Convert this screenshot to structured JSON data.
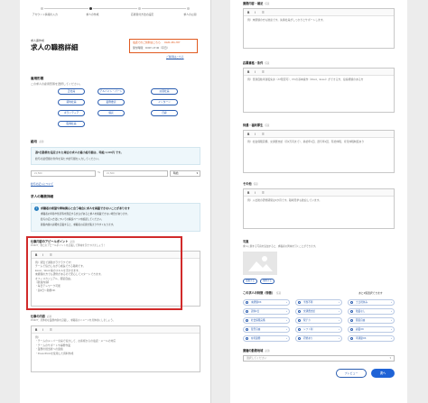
{
  "stepper": {
    "steps": [
      "アカウント情報の入力",
      "求人の作成",
      "応募受付方法の設定",
      "求人の公開"
    ],
    "current": 2
  },
  "header": {
    "subtitle": "求人票作成",
    "title": "求人の職務詳細",
    "help_line1": "電話でのご質問はこちら",
    "help_phone": "0120-451-787",
    "help_hours": "受付時間：9:00〜17:30（平日）",
    "faq_link": "ご質問はこちら"
  },
  "employment": {
    "label": "雇用形態",
    "hint": "この求人の雇用形態を選択してください。",
    "options": [
      "正社員",
      "アルバイト・パート",
      "派遣社員",
      "契約社員",
      "業務委託",
      "インターン",
      "ボランティア",
      "嘱託",
      "日雇",
      "臨時社員"
    ]
  },
  "salary": {
    "label": "給与",
    "required": "必須",
    "notice": "週5日勤務を指定された場合の求人の最小給与額は、時給 1,100円 です。",
    "notice2": "給与の最低額の条件を満たす給与額を入力してください。",
    "min_placeholder": "¥1,500",
    "max_placeholder": "¥1,500",
    "unit": "時給",
    "link": "給与の記入について"
  },
  "details_section": {
    "label": "求人の職務詳細",
    "info_title": "求職者の希望や興味関心と合う場合に求人を掲載できないことがあります",
    "info_lines": [
      "求職者の年齢や性別等を限定する文言があると求人を掲載できない場合があります。",
      "給与の記入方法についての解説ページを確認してください。",
      "募集内容の詳細を記載すると、求職者の応募が集まりやすくなります。"
    ]
  },
  "appeal": {
    "label": "仕事内容のアピールポイント",
    "required": "必須",
    "hint": "POINT：他とのアピールポイントを記載して興味を引きつけましょう！",
    "placeholder_lines": [
      "例）駅近で通勤がラクラクです！",
      "チームで協力しながら成長できる職場です。",
      "Excel、Word 等のスキルを活かせます。",
      "未経験の方でも研修があるので安心してスタートできます。",
      "オフィスカジュアル、服装自由。",
      "【募集内容】",
      "・毎日テレワーク可能",
      "・週2日〜勤務OK"
    ]
  },
  "job_content": {
    "label": "仕事の内容",
    "required": "必須",
    "hint": "POINT：具体的な業務内容を記載し、求職者のイメージを具体的にしましょう。",
    "placeholder_lines": [
      "例）",
      "・チームのメンバー全員で協力して、お客様からの電話・メールの対応",
      "・チームのサポートや事務作業",
      "・業務の担当者への連絡",
      "・PowerPointを使用した資料作成"
    ]
  },
  "right": {
    "appeal_points": {
      "label": "業務内容・補足",
      "required": "任意",
      "placeholder": "例）未経験の方も歓迎です。先輩社員がしっかりとサポートします。"
    },
    "skills": {
      "label": "応募資格・条件",
      "required": "任意",
      "placeholder": "例）普通自動車運転免許（AT限定可）、PCの基本操作（Word、Excel）ができる方、接客経験のある方"
    },
    "welfare": {
      "label": "待遇・福利厚生",
      "required": "任意",
      "placeholder": "例）社会保険完備、交通費支給（月3万円まで）、昇給年1回、賞与年2回、有給休暇、育児休暇制度あり"
    },
    "other": {
      "label": "その他",
      "required": "任意",
      "placeholder": "例）入社後の研修期間は3か月です。職場見学も歓迎しています。"
    },
    "photo": {
      "label": "写真",
      "hint": "求人に関する写真を追加すると、求職者の興味を引くことができます。",
      "btn_change": "変更する",
      "btn_delete": "削除する"
    },
    "features": {
      "label": "この求人の特徴（特徴）",
      "required": "任意",
      "counter": "あと3個選択できます",
      "items": [
        "未経験OK",
        "学歴不問",
        "土日祝休み",
        "週休2日",
        "交通費支給",
        "残業なし",
        "社会保険完備",
        "駅チカ",
        "服装自由",
        "髪型自由",
        "シフト制",
        "副業OK",
        "在宅勤務",
        "研修あり",
        "車通勤OK"
      ]
    },
    "industry": {
      "label": "業種の勤務地域",
      "required": "必須",
      "placeholder": "選択してください"
    },
    "preview_button": "プレビュー",
    "next_button": "次へ"
  }
}
